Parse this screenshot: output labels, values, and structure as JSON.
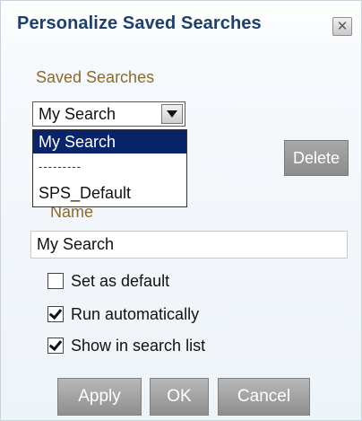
{
  "dialog": {
    "title": "Personalize Saved Searches",
    "close_icon": "close-icon"
  },
  "saved_searches": {
    "label": "Saved Searches",
    "selected": "My Search",
    "options": [
      "My Search",
      "---------",
      "SPS_Default"
    ],
    "delete_label": "Delete"
  },
  "name_field": {
    "label": "Name",
    "value": "My Search"
  },
  "options": [
    {
      "label": "Set as default",
      "checked": false
    },
    {
      "label": "Run automatically",
      "checked": true
    },
    {
      "label": "Show in search list",
      "checked": true
    }
  ],
  "buttons": {
    "apply": "Apply",
    "ok": "OK",
    "cancel": "Cancel"
  },
  "colors": {
    "title": "#1f3f66",
    "label": "#8b6a2e",
    "highlight": "#0a246a",
    "button": "#9e9e9e"
  }
}
